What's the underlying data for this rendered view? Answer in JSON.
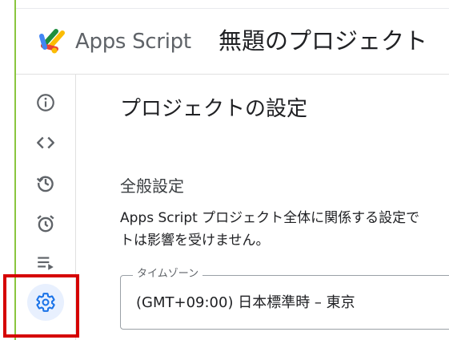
{
  "header": {
    "app_name": "Apps Script",
    "project_title": "無題のプロジェクト"
  },
  "sidebar": {
    "items": [
      {
        "icon": "info-icon"
      },
      {
        "icon": "code-icon"
      },
      {
        "icon": "history-icon"
      },
      {
        "icon": "alarm-icon"
      },
      {
        "icon": "executions-icon"
      },
      {
        "icon": "gear-icon",
        "active": true
      }
    ],
    "highlight_color": "#d50000"
  },
  "main": {
    "title": "プロジェクトの設定",
    "general": {
      "heading": "全般設定",
      "description_line1": "Apps Script プロジェクト全体に関係する設定で",
      "description_line2": "トは影響を受けません。"
    },
    "timezone": {
      "label": "タイムゾーン",
      "value": "(GMT+09:00) 日本標準時 – 東京"
    }
  },
  "colors": {
    "accent_blue": "#1a73e8",
    "active_bg": "#e8f0fe",
    "icon_gray": "#5f6368",
    "left_strip": "#8ac53f"
  }
}
